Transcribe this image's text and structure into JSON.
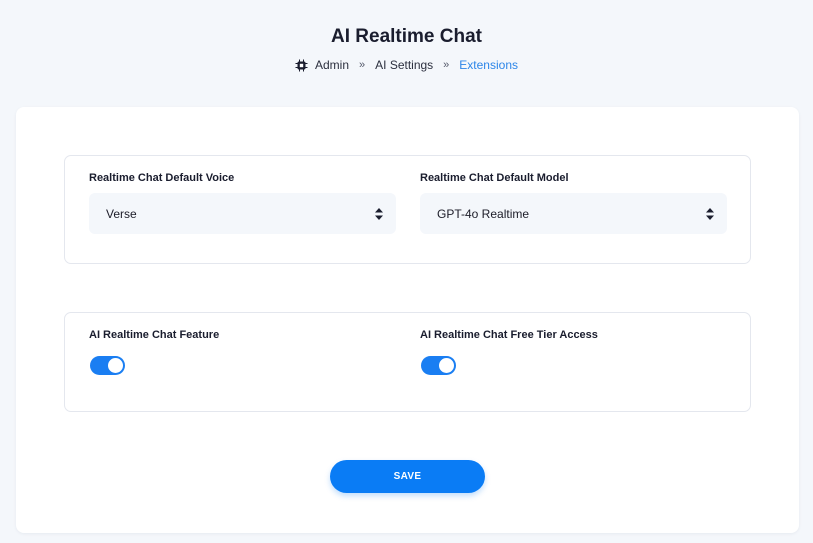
{
  "header": {
    "title": "AI Realtime Chat",
    "breadcrumb": {
      "items": [
        "Admin",
        "AI Settings",
        "Extensions"
      ],
      "separator": "»"
    }
  },
  "settings": {
    "voice": {
      "label": "Realtime Chat Default Voice",
      "selected": "Verse"
    },
    "model": {
      "label": "Realtime Chat Default Model",
      "selected": "GPT-4o Realtime"
    },
    "feature_toggle": {
      "label": "AI Realtime Chat Feature",
      "enabled": true
    },
    "free_tier_toggle": {
      "label": "AI Realtime Chat Free Tier Access",
      "enabled": true
    }
  },
  "actions": {
    "save_label": "SAVE"
  },
  "colors": {
    "accent": "#0a7cf5",
    "breadcrumb_active": "#2d86e8",
    "background": "#f4f7fb"
  }
}
